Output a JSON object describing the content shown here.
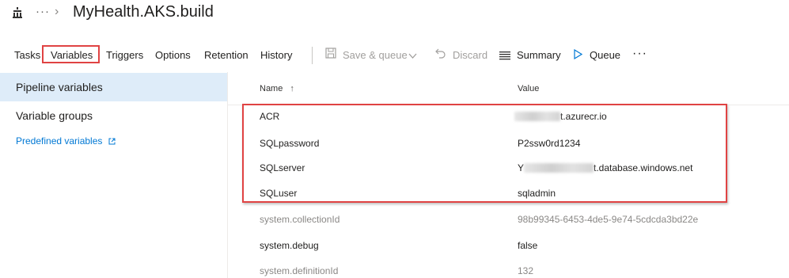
{
  "breadcrumb": {
    "more": "···",
    "separator": "›",
    "title": "MyHealth.AKS.build"
  },
  "tabs": [
    {
      "label": "Tasks"
    },
    {
      "label": "Variables",
      "selected": true
    },
    {
      "label": "Triggers"
    },
    {
      "label": "Options"
    },
    {
      "label": "Retention"
    },
    {
      "label": "History"
    }
  ],
  "actions": {
    "save_queue": "Save & queue",
    "discard": "Discard",
    "summary": "Summary",
    "queue": "Queue",
    "more": "···"
  },
  "left_nav": {
    "items": [
      {
        "label": "Pipeline variables",
        "selected": true
      },
      {
        "label": "Variable groups"
      }
    ],
    "link": "Predefined variables"
  },
  "grid": {
    "columns": {
      "name": "Name",
      "sort_indicator": "↑",
      "value": "Value"
    },
    "rows": [
      {
        "name": "ACR",
        "value_suffix": "t.azurecr.io",
        "redacted": true
      },
      {
        "name": "SQLpassword",
        "value": "P2ssw0rd1234"
      },
      {
        "name": "SQLserver",
        "value_prefix": "Y",
        "value_suffix": "t.database.windows.net",
        "redacted": true
      },
      {
        "name": "SQLuser",
        "value": "sqladmin"
      },
      {
        "name": "system.collectionId",
        "value": "98b99345-6453-4de5-9e74-5cdcda3bd22e",
        "muted": true
      },
      {
        "name": "system.debug",
        "value": "false"
      },
      {
        "name": "system.definitionId",
        "value": "132",
        "muted": true
      }
    ]
  },
  "colors": {
    "accent": "#0078d4",
    "highlight": "#e04343",
    "selected_bg": "#deecf9"
  }
}
